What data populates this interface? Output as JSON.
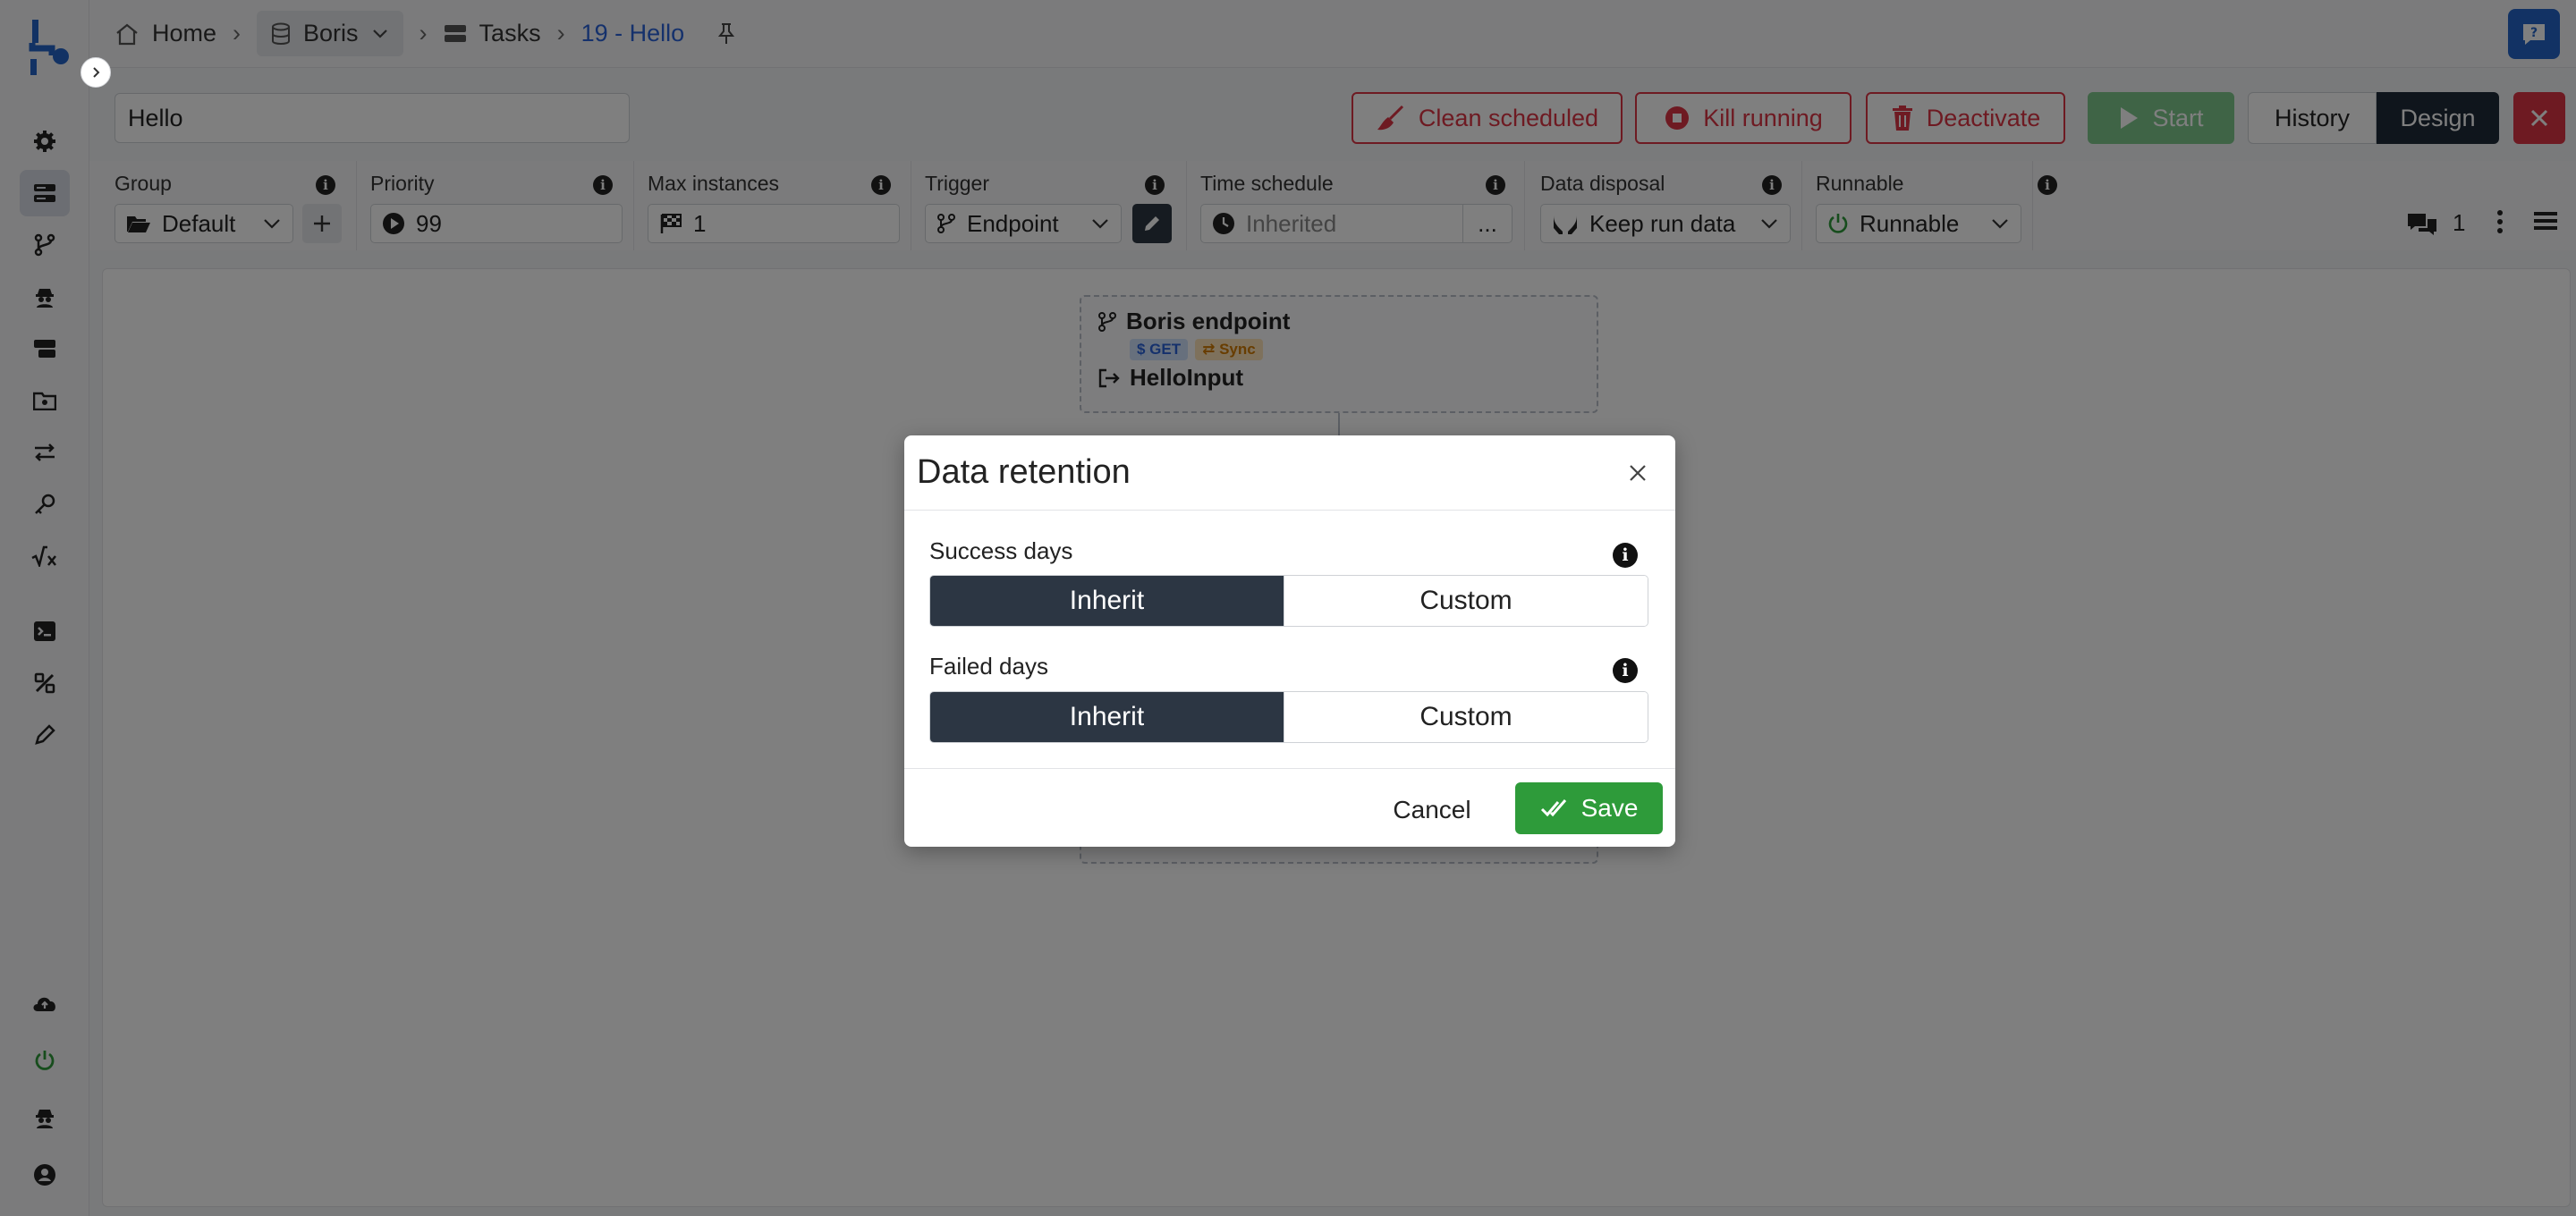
{
  "breadcrumb": {
    "home": "Home",
    "project": "Boris",
    "section": "Tasks",
    "current": "19 - Hello"
  },
  "task": {
    "name_value": "Hello"
  },
  "actions": {
    "clean_scheduled": "Clean scheduled",
    "kill_running": "Kill running",
    "deactivate": "Deactivate",
    "start": "Start",
    "history": "History",
    "design": "Design"
  },
  "settings": {
    "group": {
      "label": "Group",
      "value": "Default"
    },
    "priority": {
      "label": "Priority",
      "value": "99"
    },
    "max_instances": {
      "label": "Max instances",
      "value": "1"
    },
    "trigger": {
      "label": "Trigger",
      "value": "Endpoint"
    },
    "time_schedule": {
      "label": "Time schedule",
      "value": "Inherited",
      "more": "..."
    },
    "data_disposal": {
      "label": "Data disposal",
      "value": "Keep run data"
    },
    "runnable": {
      "label": "Runnable",
      "value": "Runnable"
    },
    "comments_count": "1"
  },
  "canvas": {
    "node": {
      "title": "Boris endpoint",
      "badges": [
        "$ GET",
        "⇄ Sync"
      ],
      "input": "HelloInput"
    }
  },
  "modal": {
    "title": "Data retention",
    "success": {
      "label": "Success days",
      "options": [
        "Inherit",
        "Custom"
      ],
      "selected": "Inherit"
    },
    "failed": {
      "label": "Failed days",
      "options": [
        "Inherit",
        "Custom"
      ],
      "selected": "Inherit"
    },
    "cancel": "Cancel",
    "save": "Save"
  },
  "colors": {
    "brand_blue": "#2465c9",
    "danger": "#dc3545",
    "success": "#2e9b3a",
    "dark": "#1f2a38"
  },
  "icons": {
    "sidebar": [
      "settings-icon",
      "tasks-icon",
      "branch-icon",
      "agent-icon",
      "queue-icon",
      "folder-icon",
      "transfer-icon",
      "key-icon",
      "formula-icon",
      "terminal-icon",
      "design-icon",
      "pen-icon",
      "cloud-icon",
      "power-icon",
      "spy-icon",
      "user-icon"
    ]
  }
}
